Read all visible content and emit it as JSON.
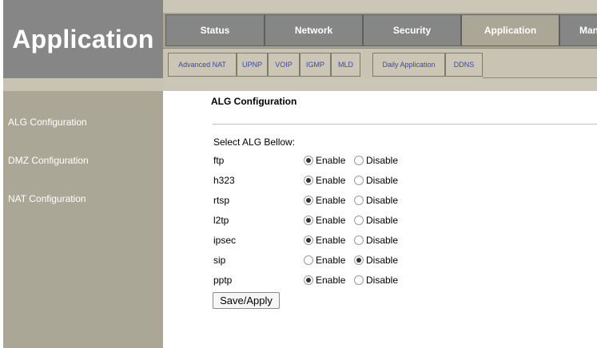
{
  "header": {
    "title": "Application"
  },
  "tabs": [
    {
      "label": "Status",
      "active": false
    },
    {
      "label": "Network",
      "active": false
    },
    {
      "label": "Security",
      "active": false
    },
    {
      "label": "Application",
      "active": true
    },
    {
      "label": "Man",
      "active": false
    }
  ],
  "subtabs": [
    "Advanced NAT",
    "UPNP",
    "VOIP",
    "IGMP",
    "MLD",
    "Daily Application",
    "DDNS"
  ],
  "sidebar": {
    "items": [
      "ALG Configuration",
      "DMZ Configuration",
      "NAT Configuration"
    ]
  },
  "main": {
    "title": "ALG Configuration",
    "select_label": "Select ALG Bellow:",
    "enable_label": "Enable",
    "disable_label": "Disable",
    "rows": [
      {
        "name": "ftp",
        "value": "Enable"
      },
      {
        "name": "h323",
        "value": "Enable"
      },
      {
        "name": "rtsp",
        "value": "Enable"
      },
      {
        "name": "l2tp",
        "value": "Enable"
      },
      {
        "name": "ipsec",
        "value": "Enable"
      },
      {
        "name": "sip",
        "value": "Disable"
      },
      {
        "name": "pptp",
        "value": "Enable"
      }
    ],
    "save_label": "Save/Apply"
  },
  "colors": {
    "banner": "#868686",
    "tab": "#868686",
    "tab_active": "#aba797",
    "sidebar": "#aba797",
    "subtab_text": "#3a4aa8"
  }
}
